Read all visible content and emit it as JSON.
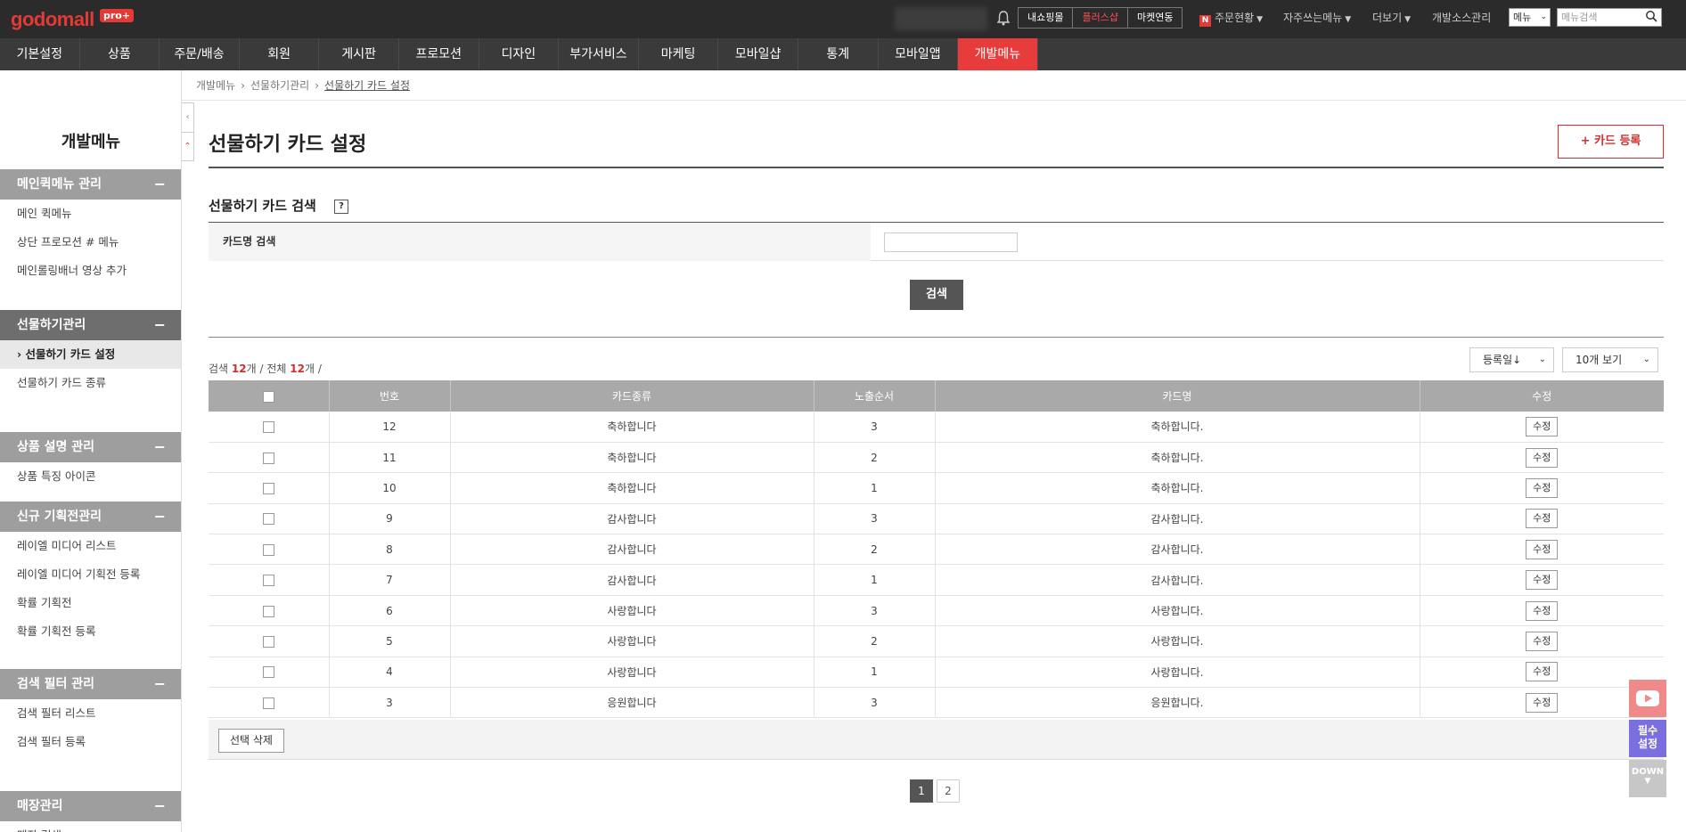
{
  "topbar": {
    "logo": "godomall",
    "logo_badge": "pro+",
    "shop_buttons": [
      "내쇼핑몰",
      "플러스샵",
      "마켓연동"
    ],
    "order_status": "주문현황",
    "favorites": "자주쓰는메뉴",
    "more": "더보기",
    "dev_source": "개발소스관리",
    "menu_select": "메뉴",
    "menu_search_placeholder": "메뉴검색"
  },
  "gnb": [
    "기본설정",
    "상품",
    "주문/배송",
    "회원",
    "게시판",
    "프로모션",
    "디자인",
    "부가서비스",
    "마케팅",
    "모바일샵",
    "통계",
    "모바일앱",
    "개발메뉴"
  ],
  "sidebar": {
    "title": "개발메뉴",
    "groups": [
      {
        "head": "메인퀵메뉴 관리",
        "items": [
          "메인 퀵메뉴",
          "상단 프로모션 # 메뉴",
          "메인롤링배너 영상 추가"
        ]
      },
      {
        "head": "선물하기관리",
        "items": [
          "선물하기 카드 설정",
          "선물하기 카드 종류"
        ]
      },
      {
        "head": "상품 설명 관리",
        "items": [
          "상품 특징 아이콘"
        ]
      },
      {
        "head": "신규 기획전관리",
        "items": [
          "레이엘 미디어 리스트",
          "레이엘 미디어 기획전 등록",
          "확률 기획전",
          "확률 기획전 등록"
        ]
      },
      {
        "head": "검색 필터 관리",
        "items": [
          "검색 필터 리스트",
          "검색 필터 등록"
        ]
      },
      {
        "head": "매장관리",
        "items": [
          "매장 검색"
        ]
      }
    ]
  },
  "breadcrumb": [
    "개발메뉴",
    "선물하기관리",
    "선물하기 카드 설정"
  ],
  "page": {
    "title": "선물하기 카드 설정",
    "register_button": "+ 카드 등록",
    "search_section_title": "선물하기 카드 검색",
    "help": "?",
    "search_label": "카드명 검색",
    "search_button": "검색",
    "count_prefix": "검색",
    "count_search": "12",
    "count_unit": "개",
    "count_total_label": "/ 전체",
    "count_total": "12",
    "count_suffix": "개 /",
    "sort_select": "등록일↓",
    "view_select": "10개 보기"
  },
  "table": {
    "headers": [
      "",
      "번호",
      "카드종류",
      "노출순서",
      "카드명",
      "수정"
    ],
    "edit_label": "수정",
    "rows": [
      {
        "no": "12",
        "type": "축하합니다",
        "order": "3",
        "name": "축하합니다."
      },
      {
        "no": "11",
        "type": "축하합니다",
        "order": "2",
        "name": "축하합니다."
      },
      {
        "no": "10",
        "type": "축하합니다",
        "order": "1",
        "name": "축하합니다."
      },
      {
        "no": "9",
        "type": "감사합니다",
        "order": "3",
        "name": "감사합니다."
      },
      {
        "no": "8",
        "type": "감사합니다",
        "order": "2",
        "name": "감사합니다."
      },
      {
        "no": "7",
        "type": "감사합니다",
        "order": "1",
        "name": "감사합니다."
      },
      {
        "no": "6",
        "type": "사랑합니다",
        "order": "3",
        "name": "사랑합니다."
      },
      {
        "no": "5",
        "type": "사랑합니다",
        "order": "2",
        "name": "사랑합니다."
      },
      {
        "no": "4",
        "type": "사랑합니다",
        "order": "1",
        "name": "사랑합니다."
      },
      {
        "no": "3",
        "type": "응원합니다",
        "order": "3",
        "name": "응원합니다."
      }
    ],
    "delete_selected": "선택 삭제"
  },
  "pager": [
    "1",
    "2"
  ],
  "floating": {
    "required": "필수\n설정",
    "down": "DOWN"
  },
  "colors": {
    "accent": "#e83b3b",
    "count": "#d32f2f",
    "required": "#7b6fe0"
  }
}
